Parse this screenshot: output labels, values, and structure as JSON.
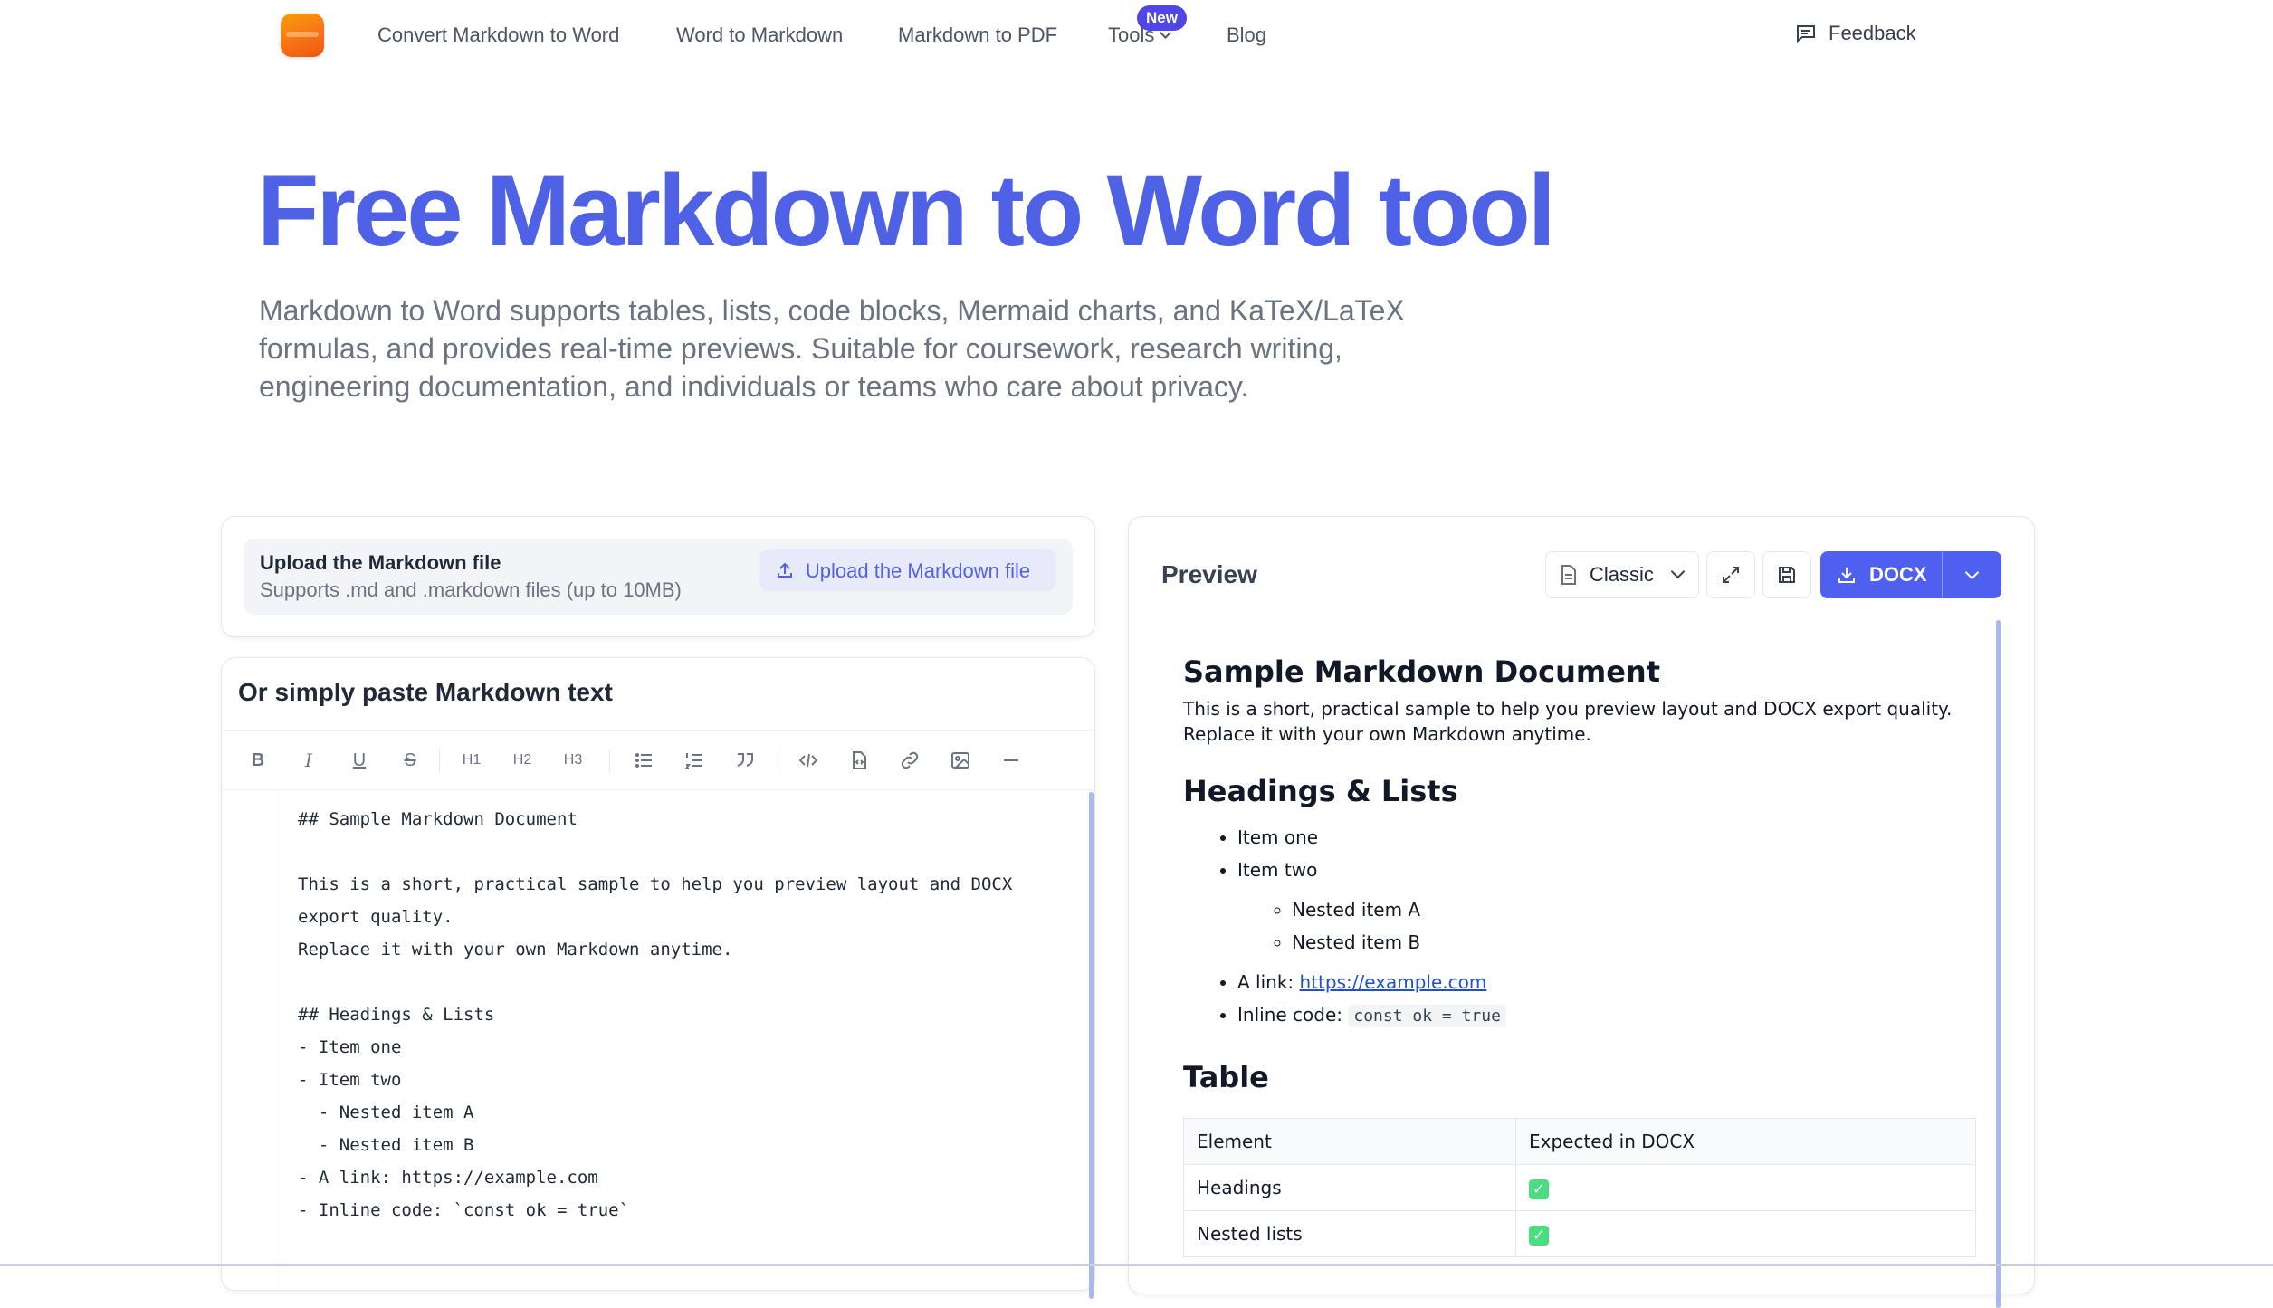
{
  "nav": {
    "links": [
      "Convert Markdown to Word",
      "Word to Markdown",
      "Markdown to PDF",
      "Tools",
      "Blog"
    ],
    "new_badge": "New",
    "feedback": "Feedback"
  },
  "hero": {
    "title": "Free Markdown to Word tool",
    "subtitle": "Markdown to Word supports tables, lists, code blocks, Mermaid charts, and KaTeX/LaTeX formulas, and provides real-time previews. Suitable for coursework, research writing, engineering documentation, and individuals or teams who care about privacy."
  },
  "upload": {
    "title": "Upload the Markdown file",
    "note": "Supports .md and .markdown files (up to 10MB)",
    "button": "Upload the Markdown file"
  },
  "editor": {
    "title": "Or simply paste Markdown text",
    "toolbar": [
      "B",
      "I",
      "U",
      "S",
      "H1",
      "H2",
      "H3",
      "bullet-list",
      "ordered-list",
      "quote",
      "code",
      "code-block",
      "link",
      "image",
      "divider"
    ],
    "content": "## Sample Markdown Document\n\nThis is a short, practical sample to help you preview layout and DOCX\nexport quality.\nReplace it with your own Markdown anytime.\n\n## Headings & Lists\n- Item one\n- Item two\n  - Nested item A\n  - Nested item B\n- A link: https://example.com\n- Inline code: `const ok = true`"
  },
  "preview": {
    "title": "Preview",
    "theme": "Classic",
    "export": "DOCX",
    "doc": {
      "h1": "Sample Markdown Document",
      "intro": "This is a short, practical sample to help you preview layout and DOCX export quality. Replace it with your own Markdown anytime.",
      "h2_lists": "Headings & Lists",
      "items": [
        "Item one",
        "Item two"
      ],
      "nested": [
        "Nested item A",
        "Nested item B"
      ],
      "link_label": "A link:",
      "link_url": "https://example.com",
      "inline_label": "Inline code:",
      "inline_code": "const ok = true",
      "h2_table": "Table",
      "table": {
        "headers": [
          "Element",
          "Expected in DOCX"
        ],
        "rows": [
          [
            "Headings",
            "✓"
          ],
          [
            "Nested lists",
            "✓"
          ]
        ]
      }
    }
  }
}
